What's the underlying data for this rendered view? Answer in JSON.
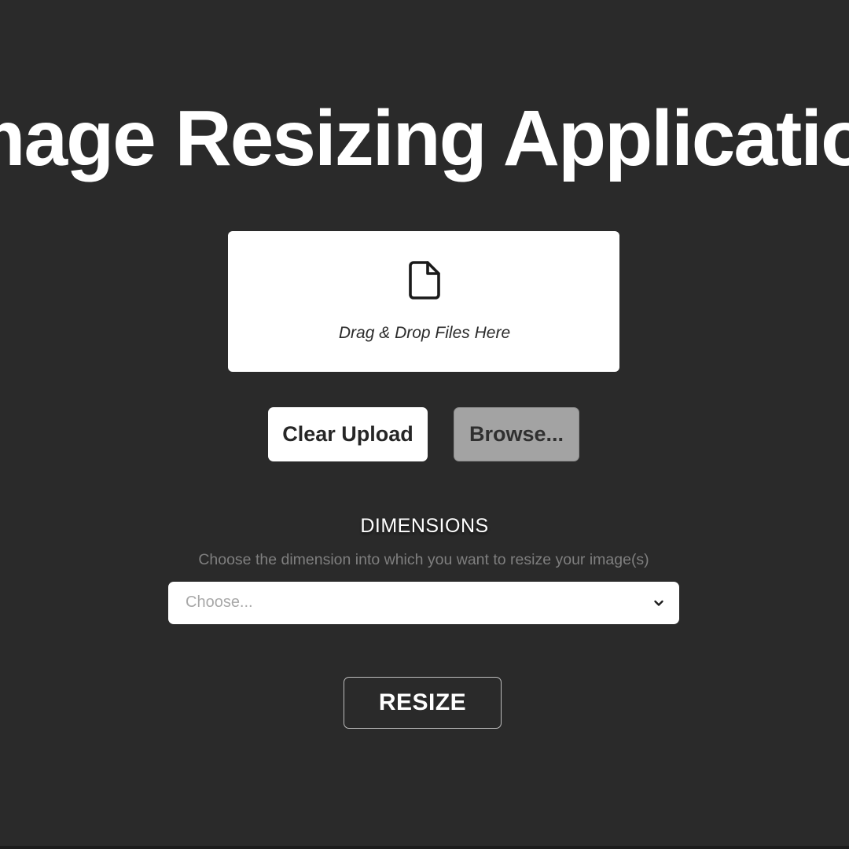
{
  "app": {
    "title": "Image Resizing Application"
  },
  "upload": {
    "icon": "file-icon",
    "drop_text": "Drag & Drop Files Here",
    "clear_label": "Clear Upload",
    "browse_label": "Browse..."
  },
  "dimensions": {
    "label": "DIMENSIONS",
    "help_text": "Choose the dimension into which you want to resize your image(s)",
    "select_placeholder": "Choose...",
    "select_icon": "chevron-down-icon"
  },
  "actions": {
    "resize_label": "RESIZE"
  },
  "colors": {
    "background": "#2a2a2a",
    "panel": "#ffffff",
    "browse_button": "#a3a3a3",
    "muted_text": "#7f7f7f"
  }
}
